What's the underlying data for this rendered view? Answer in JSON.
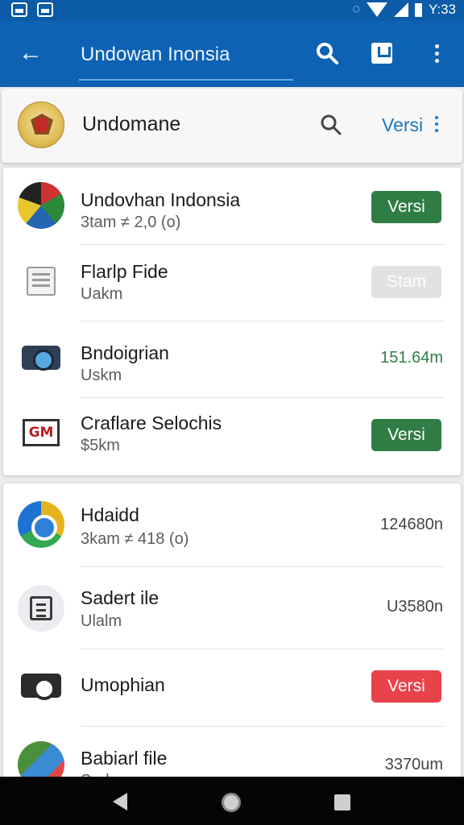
{
  "status_bar": {
    "time": "Y:33"
  },
  "app_bar": {
    "title": "Undowan Inonsia",
    "icons": [
      "back-arrow-icon",
      "search-icon",
      "save-icon",
      "more-vert-icon"
    ]
  },
  "sub_header": {
    "title": "Undomane",
    "action": "Versi",
    "icons": [
      "emblem-icon",
      "search-icon",
      "more-vert-icon"
    ]
  },
  "colors": {
    "app_bar": "#0d62b3",
    "status_bar": "#0b5ba6",
    "green_button": "#2f7d45",
    "red_button": "#e8424b",
    "link_blue": "#1a78c2"
  },
  "list_1": [
    {
      "title": "Undovhan Indonsia",
      "subtitle": "3tam ≠ 2,0 (o)",
      "action": "Versi",
      "action_style": "green",
      "icon": "flag-icon"
    },
    {
      "title": "Flarlp Fide",
      "subtitle": "Uakm",
      "action": "Stam",
      "action_style": "disabled",
      "icon": "document-icon"
    },
    {
      "title": "Bndoigrian",
      "subtitle": "Uskm",
      "meta": "151.64m",
      "icon": "camera-icon"
    },
    {
      "title": "Craflare Selochis",
      "subtitle": "$5km",
      "action": "Versi",
      "action_style": "green",
      "icon": "gm-icon"
    }
  ],
  "list_2": [
    {
      "title": "Hdaidd",
      "subtitle": "3kam ≠ 418 (o)",
      "meta": "124680n",
      "icon": "chrome-icon"
    },
    {
      "title": "Sadert ile",
      "subtitle": "Ulalm",
      "meta": "U3580n",
      "icon": "table-icon"
    },
    {
      "title": "Umophian",
      "action": "Versi",
      "action_style": "red",
      "icon": "camera-black-icon"
    },
    {
      "title": "Babiarl file",
      "subtitle": "Sadm",
      "meta": "3370um",
      "icon": "maps-icon"
    }
  ],
  "nav_bar": {
    "icons": [
      "nav-back-icon",
      "nav-home-icon",
      "nav-recents-icon"
    ]
  }
}
